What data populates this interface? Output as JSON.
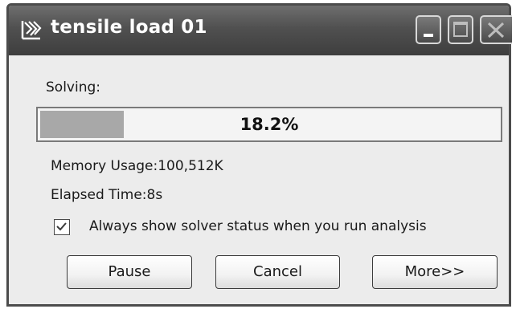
{
  "window": {
    "title": "tensile load 01"
  },
  "titlebar": {
    "app_icon": "app-logo-icon",
    "minimize_icon": "minimize-icon",
    "maximize_icon": "maximize-icon",
    "close_icon": "close-icon"
  },
  "status": {
    "solving_label": "Solving:",
    "progress_text": "18.2%",
    "progress_value": 18.2,
    "memory_label": "Memory Usage:100,512K",
    "elapsed_label": "Elapsed Time:8s"
  },
  "options": {
    "always_show_label": "Always show solver status when you run analysis",
    "always_show_checked": true
  },
  "buttons": {
    "pause_label": "Pause",
    "cancel_label": "Cancel",
    "more_label": "More>>"
  },
  "colors": {
    "titlebar": "#505050",
    "progress_fill": "#a8a8a8",
    "dialog_background": "#ececec"
  }
}
